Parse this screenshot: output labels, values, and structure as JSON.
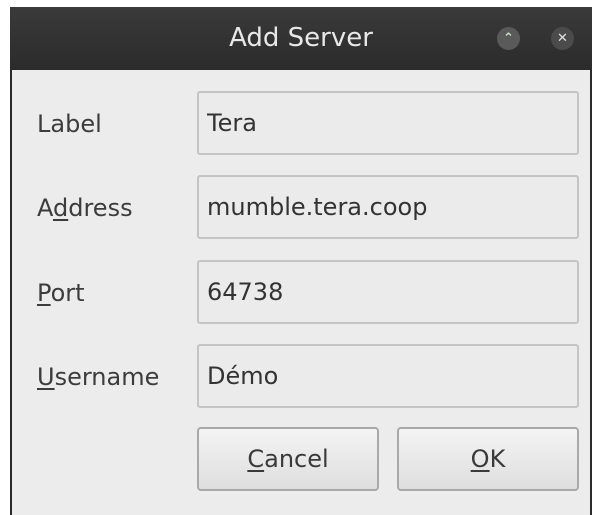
{
  "window": {
    "title": "Add Server",
    "maximize_icon": "chevron-up-icon",
    "close_icon": "close-icon"
  },
  "form": {
    "label": {
      "label": "Label",
      "value": "Tera"
    },
    "address": {
      "label_prefix": "A",
      "label_mnemonic": "d",
      "label_suffix": "dress",
      "value": "mumble.tera.coop"
    },
    "port": {
      "label_mnemonic": "P",
      "label_suffix": "ort",
      "value": "64738"
    },
    "username": {
      "label_mnemonic": "U",
      "label_suffix": "sername",
      "value": "Démo"
    }
  },
  "buttons": {
    "cancel_mnemonic": "C",
    "cancel_suffix": "ancel",
    "ok_mnemonic": "O",
    "ok_suffix": "K"
  },
  "colors": {
    "titlebar": "#2b2b2b",
    "dialog_bg": "#ececec",
    "field_bg": "#ebebeb"
  }
}
